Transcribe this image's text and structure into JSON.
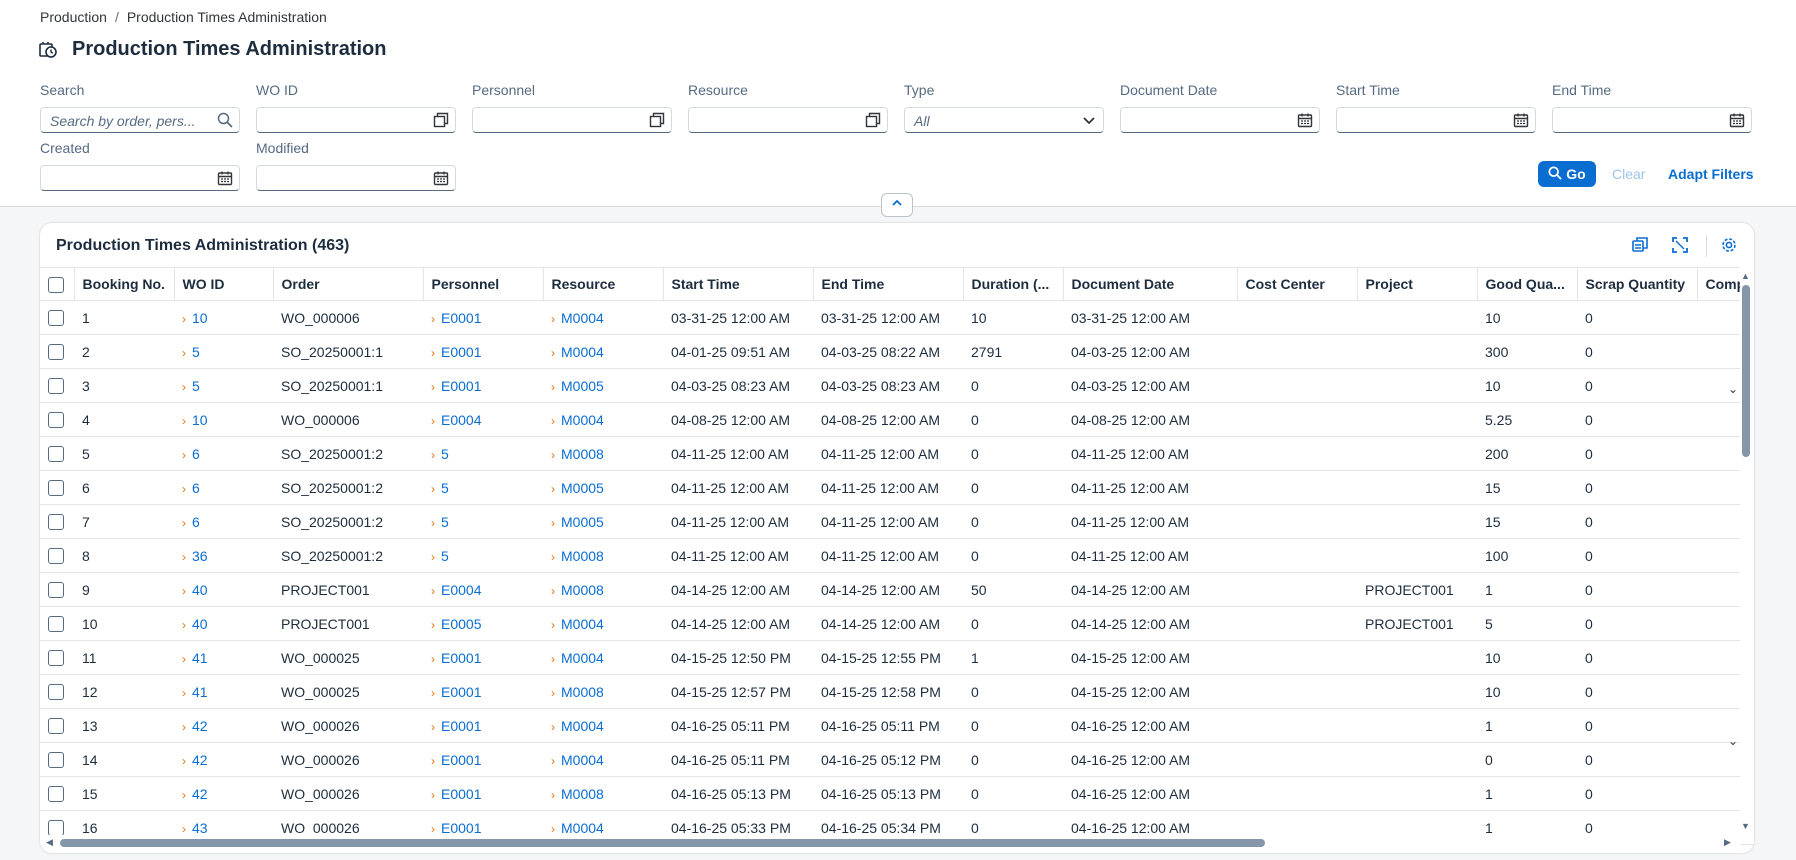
{
  "breadcrumb": {
    "parent": "Production",
    "separator": "/",
    "current": "Production Times Administration"
  },
  "page": {
    "title": "Production Times Administration"
  },
  "filters": {
    "search": {
      "label": "Search",
      "placeholder": "Search by order, pers..."
    },
    "wo_id": {
      "label": "WO ID"
    },
    "personnel": {
      "label": "Personnel"
    },
    "resource": {
      "label": "Resource"
    },
    "type": {
      "label": "Type",
      "value": "All"
    },
    "document_date": {
      "label": "Document Date"
    },
    "start_time": {
      "label": "Start Time"
    },
    "end_time": {
      "label": "End Time"
    },
    "created": {
      "label": "Created"
    },
    "modified": {
      "label": "Modified"
    }
  },
  "actions": {
    "go": "Go",
    "clear": "Clear",
    "adapt_filters": "Adapt Filters"
  },
  "table": {
    "title": "Production Times Administration (463)",
    "columns": [
      "Booking No.",
      "WO ID",
      "Order",
      "Personnel",
      "Resource",
      "Start Time",
      "End Time",
      "Duration (...",
      "Document Date",
      "Cost Center",
      "Project",
      "Good Qua...",
      "Scrap Quantity",
      "Comp"
    ],
    "rows": [
      {
        "booking": "1",
        "wo": "10",
        "order": "WO_000006",
        "personnel": "E0001",
        "resource": "M0004",
        "start": "03-31-25 12:00 AM",
        "end": "03-31-25 12:00 AM",
        "duration": "10",
        "doc_date": "03-31-25 12:00 AM",
        "cost_center": "",
        "project": "",
        "good": "10",
        "scrap": "0"
      },
      {
        "booking": "2",
        "wo": "5",
        "order": "SO_20250001:1",
        "personnel": "E0001",
        "resource": "M0004",
        "start": "04-01-25 09:51 AM",
        "end": "04-03-25 08:22 AM",
        "duration": "2791",
        "doc_date": "04-03-25 12:00 AM",
        "cost_center": "",
        "project": "",
        "good": "300",
        "scrap": "0"
      },
      {
        "booking": "3",
        "wo": "5",
        "order": "SO_20250001:1",
        "personnel": "E0001",
        "resource": "M0005",
        "start": "04-03-25 08:23 AM",
        "end": "04-03-25 08:23 AM",
        "duration": "0",
        "doc_date": "04-03-25 12:00 AM",
        "cost_center": "",
        "project": "",
        "good": "10",
        "scrap": "0"
      },
      {
        "booking": "4",
        "wo": "10",
        "order": "WO_000006",
        "personnel": "E0004",
        "resource": "M0004",
        "start": "04-08-25 12:00 AM",
        "end": "04-08-25 12:00 AM",
        "duration": "0",
        "doc_date": "04-08-25 12:00 AM",
        "cost_center": "",
        "project": "",
        "good": "5.25",
        "scrap": "0"
      },
      {
        "booking": "5",
        "wo": "6",
        "order": "SO_20250001:2",
        "personnel": "5",
        "resource": "M0008",
        "start": "04-11-25 12:00 AM",
        "end": "04-11-25 12:00 AM",
        "duration": "0",
        "doc_date": "04-11-25 12:00 AM",
        "cost_center": "",
        "project": "",
        "good": "200",
        "scrap": "0"
      },
      {
        "booking": "6",
        "wo": "6",
        "order": "SO_20250001:2",
        "personnel": "5",
        "resource": "M0005",
        "start": "04-11-25 12:00 AM",
        "end": "04-11-25 12:00 AM",
        "duration": "0",
        "doc_date": "04-11-25 12:00 AM",
        "cost_center": "",
        "project": "",
        "good": "15",
        "scrap": "0"
      },
      {
        "booking": "7",
        "wo": "6",
        "order": "SO_20250001:2",
        "personnel": "5",
        "resource": "M0005",
        "start": "04-11-25 12:00 AM",
        "end": "04-11-25 12:00 AM",
        "duration": "0",
        "doc_date": "04-11-25 12:00 AM",
        "cost_center": "",
        "project": "",
        "good": "15",
        "scrap": "0"
      },
      {
        "booking": "8",
        "wo": "36",
        "order": "SO_20250001:2",
        "personnel": "5",
        "resource": "M0008",
        "start": "04-11-25 12:00 AM",
        "end": "04-11-25 12:00 AM",
        "duration": "0",
        "doc_date": "04-11-25 12:00 AM",
        "cost_center": "",
        "project": "",
        "good": "100",
        "scrap": "0"
      },
      {
        "booking": "9",
        "wo": "40",
        "order": "PROJECT001",
        "personnel": "E0004",
        "resource": "M0008",
        "start": "04-14-25 12:00 AM",
        "end": "04-14-25 12:00 AM",
        "duration": "50",
        "doc_date": "04-14-25 12:00 AM",
        "cost_center": "",
        "project": "PROJECT001",
        "good": "1",
        "scrap": "0"
      },
      {
        "booking": "10",
        "wo": "40",
        "order": "PROJECT001",
        "personnel": "E0005",
        "resource": "M0004",
        "start": "04-14-25 12:00 AM",
        "end": "04-14-25 12:00 AM",
        "duration": "0",
        "doc_date": "04-14-25 12:00 AM",
        "cost_center": "",
        "project": "PROJECT001",
        "good": "5",
        "scrap": "0"
      },
      {
        "booking": "11",
        "wo": "41",
        "order": "WO_000025",
        "personnel": "E0001",
        "resource": "M0004",
        "start": "04-15-25 12:50 PM",
        "end": "04-15-25 12:55 PM",
        "duration": "1",
        "doc_date": "04-15-25 12:00 AM",
        "cost_center": "",
        "project": "",
        "good": "10",
        "scrap": "0"
      },
      {
        "booking": "12",
        "wo": "41",
        "order": "WO_000025",
        "personnel": "E0001",
        "resource": "M0008",
        "start": "04-15-25 12:57 PM",
        "end": "04-15-25 12:58 PM",
        "duration": "0",
        "doc_date": "04-15-25 12:00 AM",
        "cost_center": "",
        "project": "",
        "good": "10",
        "scrap": "0"
      },
      {
        "booking": "13",
        "wo": "42",
        "order": "WO_000026",
        "personnel": "E0001",
        "resource": "M0004",
        "start": "04-16-25 05:11 PM",
        "end": "04-16-25 05:11 PM",
        "duration": "0",
        "doc_date": "04-16-25 12:00 AM",
        "cost_center": "",
        "project": "",
        "good": "1",
        "scrap": "0"
      },
      {
        "booking": "14",
        "wo": "42",
        "order": "WO_000026",
        "personnel": "E0001",
        "resource": "M0004",
        "start": "04-16-25 05:11 PM",
        "end": "04-16-25 05:12 PM",
        "duration": "0",
        "doc_date": "04-16-25 12:00 AM",
        "cost_center": "",
        "project": "",
        "good": "0",
        "scrap": "0"
      },
      {
        "booking": "15",
        "wo": "42",
        "order": "WO_000026",
        "personnel": "E0001",
        "resource": "M0008",
        "start": "04-16-25 05:13 PM",
        "end": "04-16-25 05:13 PM",
        "duration": "0",
        "doc_date": "04-16-25 12:00 AM",
        "cost_center": "",
        "project": "",
        "good": "1",
        "scrap": "0"
      },
      {
        "booking": "16",
        "wo": "43",
        "order": "WO_000026",
        "personnel": "E0001",
        "resource": "M0004",
        "start": "04-16-25 05:33 PM",
        "end": "04-16-25 05:34 PM",
        "duration": "0",
        "doc_date": "04-16-25 12:00 AM",
        "cost_center": "",
        "project": "",
        "good": "1",
        "scrap": "0"
      }
    ]
  },
  "colors": {
    "accent": "#0a6ed1",
    "link_chevron": "#e9730c",
    "text": "#1d2d3e",
    "muted": "#556b82"
  },
  "icons": {
    "title": "production-time-icon",
    "search": "search-icon",
    "value_help": "value-help-icon",
    "calendar": "calendar-icon",
    "dropdown": "chevron-down-icon",
    "collapse": "chevron-up-icon",
    "toolbar": [
      "copy-icon",
      "fullscreen-icon",
      "settings-icon"
    ]
  }
}
